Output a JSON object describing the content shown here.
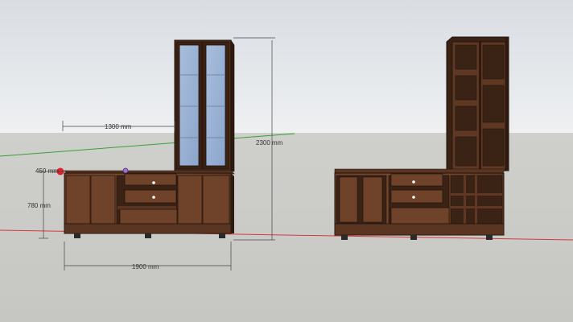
{
  "viewport": {
    "sky_color": "#e6e8eb",
    "ground_color": "#cfcfcc",
    "axis_red": "#d23a3a",
    "axis_green": "#3aa03a",
    "wood_main": "#6b4129",
    "wood_dark": "#3a2215",
    "glass_color": "#9fb6d6"
  },
  "dimensions": {
    "width_upper": "1300 mm",
    "height_total": "2300 mm",
    "height_base": "780 mm",
    "depth": "450 mm",
    "width_total": "1900 mm"
  }
}
